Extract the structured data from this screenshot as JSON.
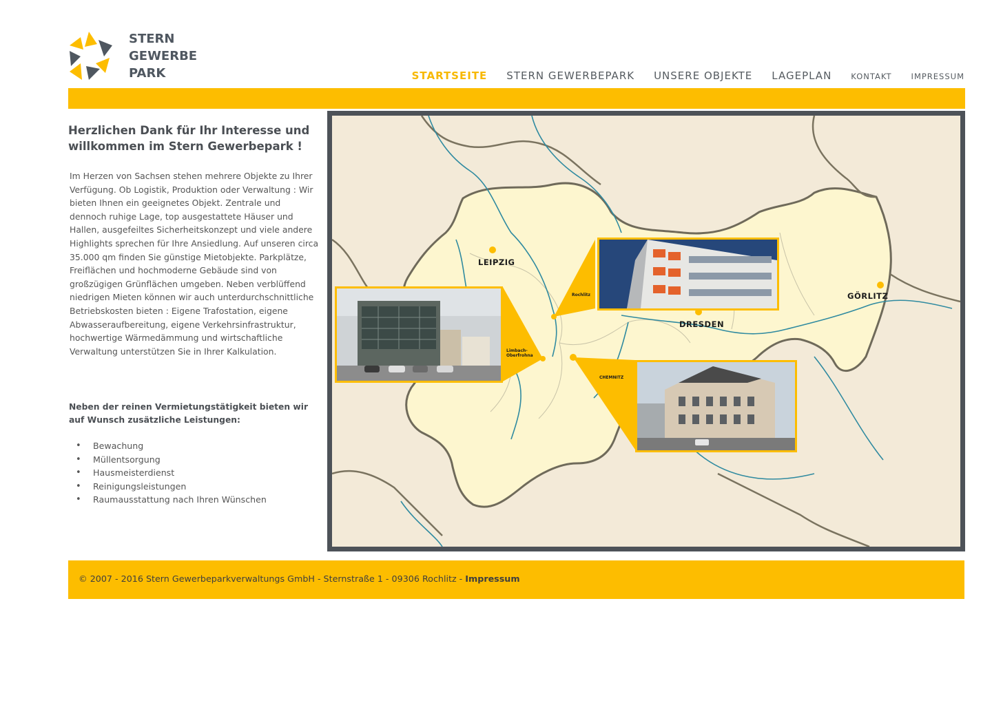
{
  "brand": {
    "line1": "STERN",
    "line2": "GEWERBE",
    "line3": "PARK",
    "colors": {
      "yellow": "#fdbd00",
      "dark": "#4f5760"
    }
  },
  "nav": {
    "items": [
      {
        "label": "STARTSEITE",
        "active": true
      },
      {
        "label": "STERN GEWERBEPARK"
      },
      {
        "label": "UNSERE OBJEKTE"
      },
      {
        "label": "LAGEPLAN"
      },
      {
        "label": "KONTAKT"
      },
      {
        "label": "IMPRESSUM"
      }
    ]
  },
  "intro": {
    "title": "Herzlichen Dank für Ihr Interesse und willkommen im Stern Gewerbepark !",
    "text": "Im Herzen von Sachsen stehen mehrere Objekte zu Ihrer Verfügung. Ob Logistik, Produktion oder Verwaltung : Wir bieten Ihnen ein geeignetes Objekt. Zentrale und dennoch ruhige Lage, top ausgestattete Häuser und Hallen, ausgefeiltes Sicherheitskonzept und viele andere Highlights sprechen für Ihre Ansiedlung. Auf unseren circa 35.000 qm finden Sie günstige Mietobjekte. Parkplätze, Freiflächen und hochmoderne Gebäude sind von großzügigen Grünflächen umgeben. Neben verblüffend niedrigen Mieten können wir auch unterdurchschnittliche Betriebskosten bieten : Eigene Trafostation, eigene Abwasseraufbereitung, eigene Verkehrsinfrastruktur, hochwertige Wärmedämmung und wirtschaftliche Verwaltung unterstützen Sie in Ihrer Kalkulation."
  },
  "services": {
    "title": "Neben der reinen Vermietungstätigkeit bieten wir auf Wunsch zusätzliche Leistungen:",
    "items": [
      "Bewachung",
      "Müllentsorgung",
      "Hausmeisterdienst",
      "Reinigungsleistungen",
      "Raumausstattung nach Ihren Wünschen"
    ]
  },
  "map": {
    "cities": {
      "leipzig": "LEIPZIG",
      "dresden": "DRESDEN",
      "goerlitz": "GÖRLITZ"
    },
    "callouts": {
      "rochlitz": "Rochlitz",
      "limbach_line1": "Limbach-",
      "limbach_line2": "Oberfrohna",
      "chemnitz": "CHEMNITZ"
    }
  },
  "footer": {
    "text": "© 2007 - 2016 Stern Gewerbeparkverwaltungs GmbH - Sternstraße 1 - 09306 Rochlitz - ",
    "link": "Impressum"
  }
}
